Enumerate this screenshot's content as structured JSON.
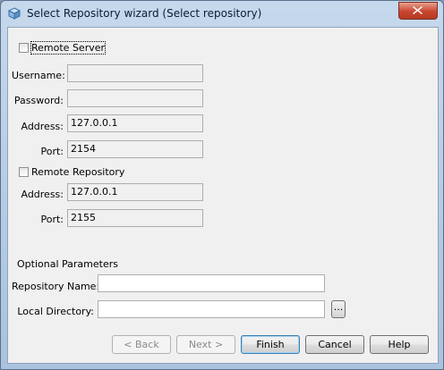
{
  "window": {
    "title": "Select Repository wizard (Select repository)"
  },
  "remote_server": {
    "checkbox_label": "Remote Server",
    "checked": false,
    "username_label": "Username:",
    "username_value": "",
    "password_label": "Password:",
    "password_value": "",
    "address_label": "Address:",
    "address_value": "127.0.0.1",
    "port_label": "Port:",
    "port_value": "2154"
  },
  "remote_repository": {
    "checkbox_label": "Remote Repository",
    "checked": false,
    "address_label": "Address:",
    "address_value": "127.0.0.1",
    "port_label": "Port:",
    "port_value": "2155"
  },
  "optional": {
    "heading": "Optional Parameters",
    "repo_name_label": "Repository Name:",
    "repo_name_value": "",
    "local_dir_label": "Local Directory:",
    "local_dir_value": "",
    "browse_label": "..."
  },
  "buttons": {
    "back": "< Back",
    "next": "Next >",
    "finish": "Finish",
    "cancel": "Cancel",
    "help": "Help"
  },
  "colors": {
    "titlebar": "#bcd1e8",
    "close": "#c8452e",
    "dialog_bg": "#f0f0f0",
    "default_button_border": "#3c7fb1"
  }
}
